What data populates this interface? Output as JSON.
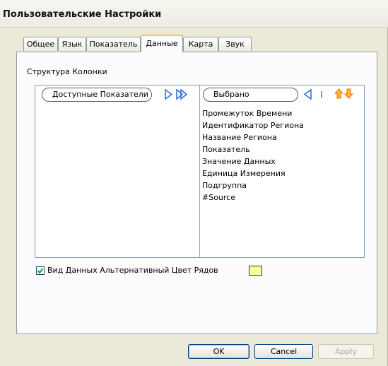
{
  "window": {
    "title": "Пользовательские Настройки"
  },
  "tabs": [
    {
      "label": "Общее"
    },
    {
      "label": "Язык"
    },
    {
      "label": "Показатель"
    },
    {
      "label": "Данные"
    },
    {
      "label": "Карта"
    },
    {
      "label": "Звук"
    }
  ],
  "active_tab": "Данные",
  "section": {
    "title": "Структура Колонки"
  },
  "available": {
    "header": "Доступные Показатели"
  },
  "selected": {
    "header": "Выбрано",
    "items": [
      "Промежуток Времени",
      "Идентификатор Региона",
      "Название Региона",
      "Показатель",
      "Значение Данных",
      "Единица Измерения",
      "Подгруппа",
      "#Source"
    ]
  },
  "alt_rows": {
    "label": "Вид Данных Альтернативный Цвет Рядов",
    "checked": true,
    "color": "#ffff99"
  },
  "buttons": {
    "ok": "OK",
    "cancel": "Cancel",
    "apply": "Apply"
  },
  "colors": {
    "accent_arrow": "#2f6fdf",
    "move_up_down": "#ff8c00",
    "tab_highlight": "#ffc83c"
  }
}
